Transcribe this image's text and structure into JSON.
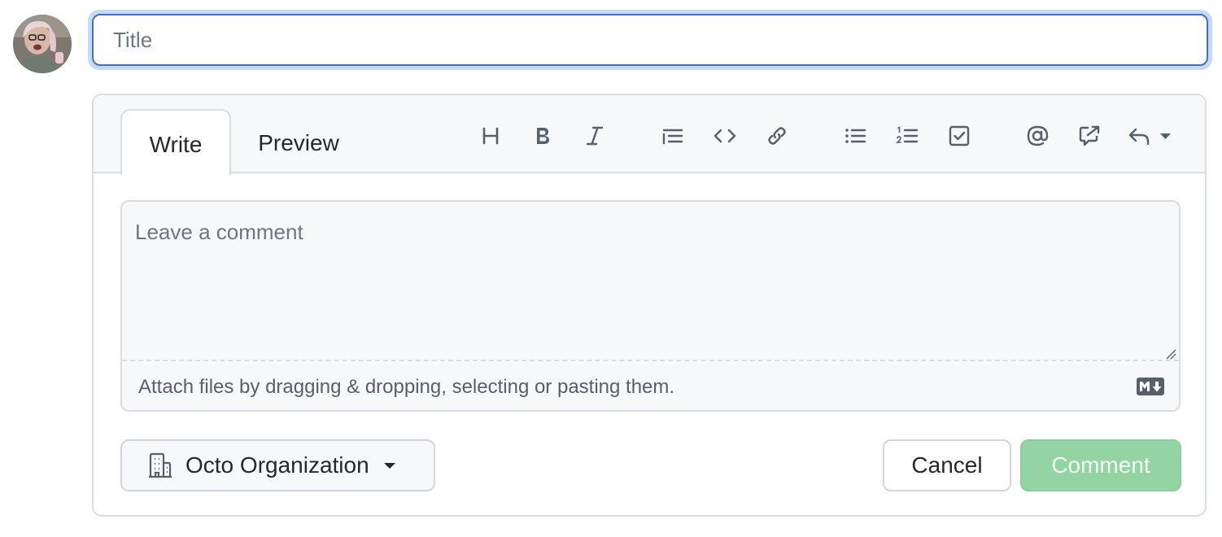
{
  "title_field": {
    "placeholder": "Title",
    "value": ""
  },
  "tabs": [
    {
      "label": "Write",
      "active": true
    },
    {
      "label": "Preview",
      "active": false
    }
  ],
  "toolbar": {
    "icons": [
      "heading-icon",
      "bold-icon",
      "italic-icon",
      "quote-icon",
      "code-icon",
      "link-icon",
      "bulleted-list-icon",
      "numbered-list-icon",
      "task-list-icon",
      "mention-icon",
      "cross-reference-icon",
      "reply-icon"
    ]
  },
  "comment": {
    "placeholder": "Leave a comment",
    "value": "",
    "attach_hint": "Attach files by dragging & dropping, selecting or pasting them."
  },
  "org_selector": {
    "label": "Octo Organization"
  },
  "actions": {
    "cancel_label": "Cancel",
    "submit_label": "Comment"
  },
  "colors": {
    "focus_ring": "#c6daf3",
    "focus_border": "#3b73d1",
    "submit_disabled": "#94d3a2",
    "border": "#d8dee4",
    "icon": "#57606a"
  }
}
